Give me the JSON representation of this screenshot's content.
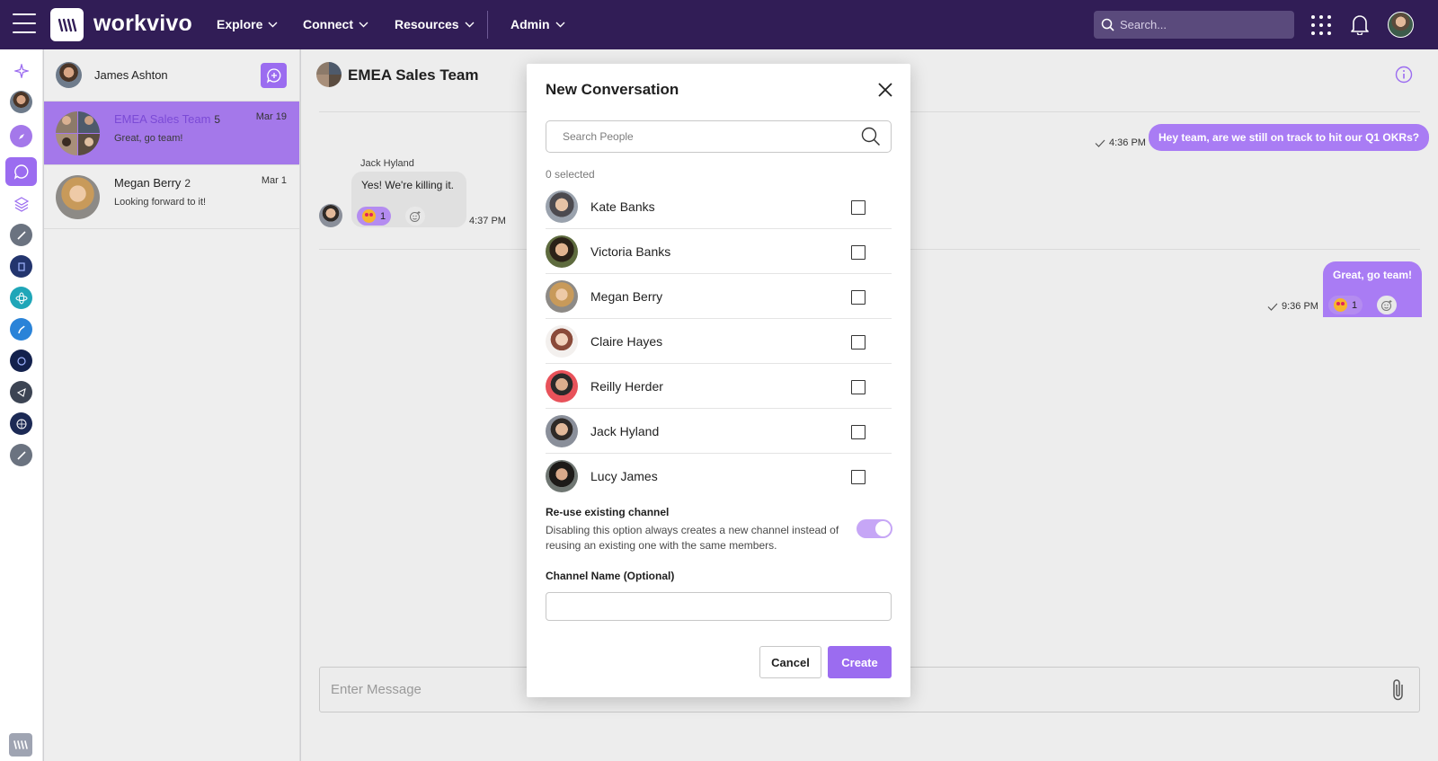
{
  "topbar": {
    "brand": "workvivo",
    "nav": [
      "Explore",
      "Connect",
      "Resources",
      "Admin"
    ],
    "search_placeholder": "Search..."
  },
  "sidebar_user": {
    "name": "James Ashton"
  },
  "conversations": [
    {
      "title": "EMEA Sales Team",
      "count": "5",
      "date": "Mar 19",
      "snippet": "Great, go team!"
    },
    {
      "title": "Megan Berry",
      "count": "2",
      "date": "Mar 1",
      "snippet": "Looking forward to it!"
    }
  ],
  "chat": {
    "title": "EMEA Sales Team",
    "messages": {
      "out1": {
        "text": "Hey team, are we still on track to hit our Q1 OKRs?",
        "time": "4:36 PM"
      },
      "in1": {
        "sender": "Jack Hyland",
        "text": "Yes! We're killing it.",
        "time": "4:37 PM",
        "reaction_count": "1"
      },
      "out2": {
        "text": "Great, go team!",
        "time": "9:36 PM",
        "reaction_count": "1"
      }
    },
    "composer_placeholder": "Enter Message"
  },
  "modal": {
    "title": "New Conversation",
    "search_placeholder": "Search People",
    "selected_count": "0 selected",
    "people": [
      {
        "name": "Kate Banks",
        "checked": false
      },
      {
        "name": "Victoria Banks",
        "checked": false
      },
      {
        "name": "Megan Berry",
        "checked": false
      },
      {
        "name": "Claire Hayes",
        "checked": false
      },
      {
        "name": "Reilly Herder",
        "checked": false
      },
      {
        "name": "Jack Hyland",
        "checked": false
      },
      {
        "name": "Lucy James",
        "checked": false
      }
    ],
    "reuse_title": "Re-use existing channel",
    "reuse_desc": "Disabling this option always creates a new channel instead of reusing an existing one with the same members.",
    "reuse_enabled": true,
    "channel_label": "Channel Name (Optional)",
    "channel_value": "",
    "cancel_label": "Cancel",
    "create_label": "Create"
  },
  "colors": {
    "nav_bg": "#311d56",
    "accent": "#9b6cf0"
  }
}
